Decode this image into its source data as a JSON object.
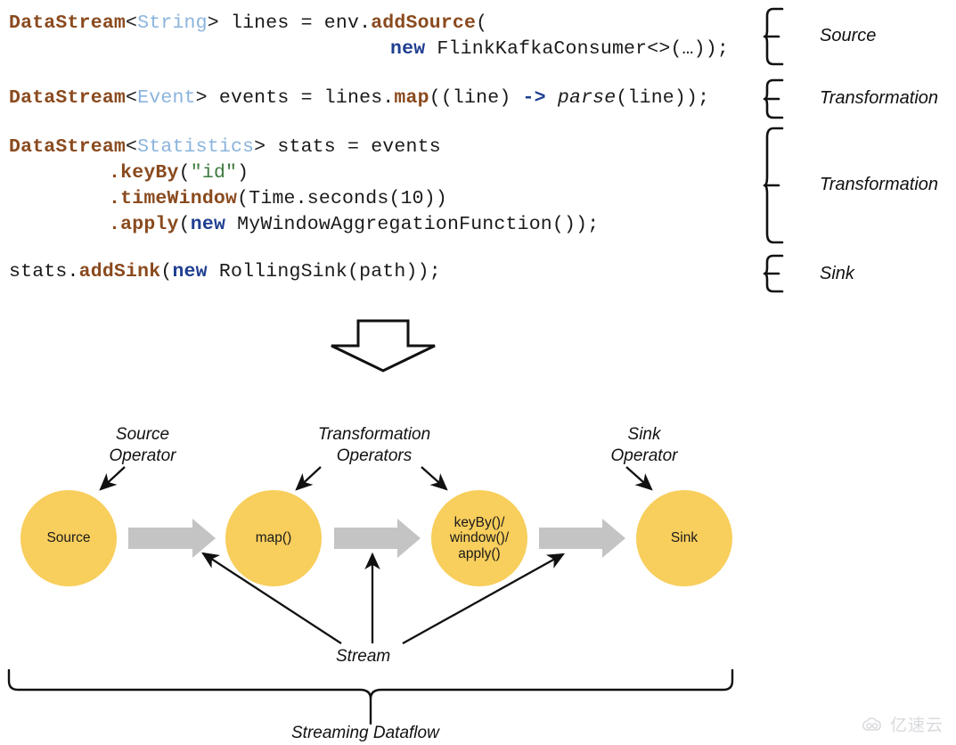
{
  "code": {
    "lines": [
      {
        "id": "line-1",
        "tokens": [
          {
            "t": "DataStream",
            "c": "tok-type"
          },
          {
            "t": "<",
            "c": "tok-plain"
          },
          {
            "t": "String",
            "c": "tok-generic"
          },
          {
            "t": "> lines = env.",
            "c": "tok-plain"
          },
          {
            "t": "addSource",
            "c": "tok-method"
          },
          {
            "t": "(",
            "c": "tok-plain"
          }
        ]
      },
      {
        "id": "line-2",
        "tokens": [
          {
            "t": "new",
            "c": "tok-kw"
          },
          {
            "t": " FlinkKafkaConsumer<>(…));",
            "c": "tok-plain"
          }
        ]
      },
      {
        "id": "line-3",
        "tokens": [
          {
            "t": "DataStream",
            "c": "tok-type"
          },
          {
            "t": "<",
            "c": "tok-plain"
          },
          {
            "t": "Event",
            "c": "tok-generic"
          },
          {
            "t": "> events = lines.",
            "c": "tok-plain"
          },
          {
            "t": "map",
            "c": "tok-method"
          },
          {
            "t": "((line) ",
            "c": "tok-plain"
          },
          {
            "t": "->",
            "c": "tok-kw"
          },
          {
            "t": " ",
            "c": "tok-plain"
          },
          {
            "t": "parse",
            "c": "tok-ital"
          },
          {
            "t": "(line));",
            "c": "tok-plain"
          }
        ]
      },
      {
        "id": "line-4",
        "tokens": [
          {
            "t": "DataStream",
            "c": "tok-type"
          },
          {
            "t": "<",
            "c": "tok-plain"
          },
          {
            "t": "Statistics",
            "c": "tok-generic"
          },
          {
            "t": "> stats = events",
            "c": "tok-plain"
          }
        ]
      },
      {
        "id": "line-5",
        "tokens": [
          {
            "t": ".",
            "c": "tok-method"
          },
          {
            "t": "keyBy",
            "c": "tok-method"
          },
          {
            "t": "(",
            "c": "tok-plain"
          },
          {
            "t": "\"id\"",
            "c": "tok-str"
          },
          {
            "t": ")",
            "c": "tok-plain"
          }
        ]
      },
      {
        "id": "line-6",
        "tokens": [
          {
            "t": ".",
            "c": "tok-method"
          },
          {
            "t": "timeWindow",
            "c": "tok-method"
          },
          {
            "t": "(Time.seconds(10))",
            "c": "tok-plain"
          }
        ]
      },
      {
        "id": "line-7",
        "tokens": [
          {
            "t": ".",
            "c": "tok-method"
          },
          {
            "t": "apply",
            "c": "tok-method"
          },
          {
            "t": "(",
            "c": "tok-plain"
          },
          {
            "t": "new",
            "c": "tok-kw"
          },
          {
            "t": " MyWindowAggregationFunction());",
            "c": "tok-plain"
          }
        ]
      },
      {
        "id": "line-8",
        "tokens": [
          {
            "t": "stats.",
            "c": "tok-plain"
          },
          {
            "t": "addSink",
            "c": "tok-method"
          },
          {
            "t": "(",
            "c": "tok-plain"
          },
          {
            "t": "new",
            "c": "tok-kw"
          },
          {
            "t": " RollingSink(path));",
            "c": "tok-plain"
          }
        ]
      }
    ]
  },
  "brace_labels": {
    "source": "Source",
    "transformation_1": "Transformation",
    "transformation_2": "Transformation",
    "sink": "Sink"
  },
  "diagram": {
    "nodes": [
      {
        "id": "node-source",
        "label": "Source"
      },
      {
        "id": "node-map",
        "label": "map()"
      },
      {
        "id": "node-window",
        "label": "keyBy()/\nwindow()/\napply()"
      },
      {
        "id": "node-sink",
        "label": "Sink"
      }
    ],
    "captions": {
      "source_operator": "Source\nOperator",
      "transformation_operators": "Transformation\nOperators",
      "sink_operator": "Sink\nOperator"
    },
    "stream_label": "Stream",
    "dataflow_label": "Streaming Dataflow"
  },
  "colors": {
    "node_fill": "#F8CE5C",
    "flow_arrow": "#C4C4C4",
    "type_token": "#8a4a1e",
    "generic_token": "#8ab4dd",
    "keyword_token": "#1f3f91",
    "string_token": "#3f7a3f",
    "ink": "#111111"
  },
  "watermark": {
    "text": "亿速云",
    "icon": "cloud-icon"
  }
}
